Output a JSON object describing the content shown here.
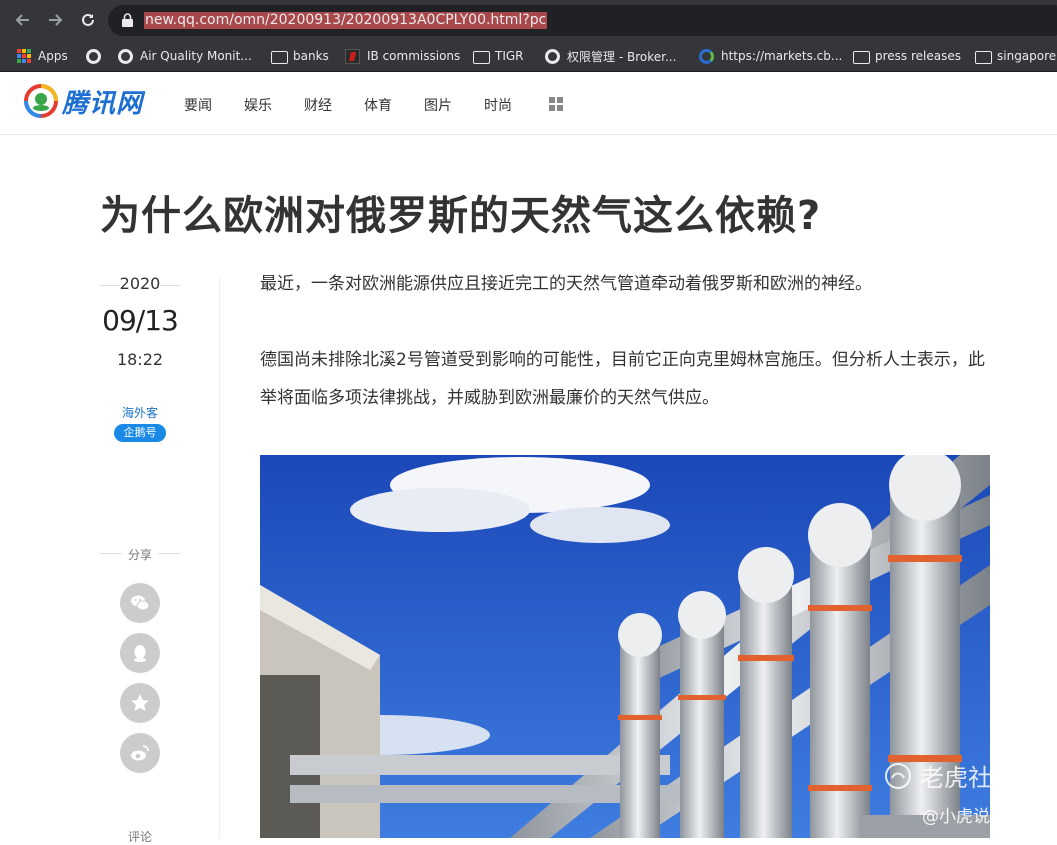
{
  "browser": {
    "url": "new.qq.com/omn/20200913/20200913A0CPLY00.html?pc",
    "back_icon": "arrow-left-icon",
    "forward_icon": "arrow-right-icon",
    "reload_icon": "reload-icon",
    "lock_icon": "lock-icon"
  },
  "bookmarks": [
    {
      "label": "Apps",
      "icon": "apps-grid-icon"
    },
    {
      "label": "",
      "icon": "globe-icon"
    },
    {
      "label": "Air Quality Monit...",
      "icon": "globe-icon"
    },
    {
      "label": "banks",
      "icon": "folder-icon"
    },
    {
      "label": "IB commissions",
      "icon": "ib-icon"
    },
    {
      "label": "TIGR",
      "icon": "folder-icon"
    },
    {
      "label": "权限管理 - Broker...",
      "icon": "globe-icon"
    },
    {
      "label": "https://markets.cb...",
      "icon": "cb-icon"
    },
    {
      "label": "press releases",
      "icon": "folder-icon"
    },
    {
      "label": "singapore",
      "icon": "folder-icon"
    }
  ],
  "site": {
    "logo_text": "腾讯网",
    "nav": [
      "要闻",
      "娱乐",
      "财经",
      "体育",
      "图片",
      "时尚"
    ],
    "more_icon": "grid-icon"
  },
  "article": {
    "title": "为什么欧洲对俄罗斯的天然气这么依赖?",
    "year": "2020",
    "date": "09/13",
    "time": "18:22",
    "author": "海外客",
    "author_badge": "企鹅号",
    "share_label": "分享",
    "share_icons": [
      "wechat-icon",
      "qq-icon",
      "qzone-star-icon",
      "weibo-icon"
    ],
    "comment_label": "评论",
    "paragraphs": [
      "最近，一条对欧洲能源供应且接近完工的天然气管道牵动着俄罗斯和欧洲的神经。",
      "德国尚未排除北溪2号管道受到影响的可能性，目前它正向克里姆林宫施压。但分析人士表示，此举将面临多项法律挑战，并威胁到欧洲最廉价的天然气供应。"
    ],
    "watermark_main": "老虎社区",
    "watermark_sub": "@小虎说英股"
  },
  "colors": {
    "browser_chrome": "#35363a",
    "url_highlight": "#a8484a",
    "logo_blue": "#1d6fd4",
    "badge_blue": "#1a8ae6",
    "title_text": "#333333"
  }
}
